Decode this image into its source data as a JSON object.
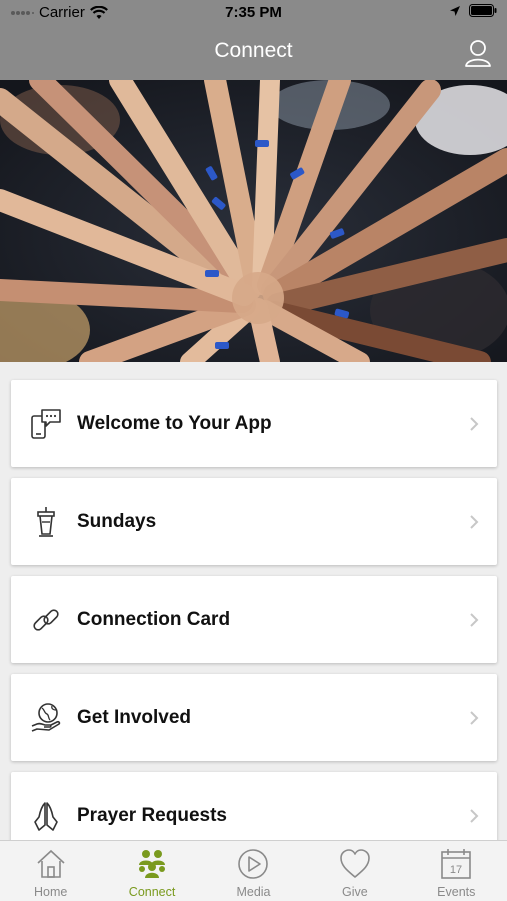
{
  "status": {
    "carrier": "Carrier",
    "time": "7:35 PM"
  },
  "header": {
    "title": "Connect"
  },
  "hero": {
    "icon": "photo-hands-together"
  },
  "items": [
    {
      "label": "Welcome to Your App",
      "icon": "chat-phone-icon"
    },
    {
      "label": "Sundays",
      "icon": "pulpit-icon"
    },
    {
      "label": "Connection Card",
      "icon": "link-icon"
    },
    {
      "label": "Get Involved",
      "icon": "globe-hand-icon"
    },
    {
      "label": "Prayer Requests",
      "icon": "praying-hands-icon"
    }
  ],
  "tabs": [
    {
      "label": "Home",
      "icon": "home-icon"
    },
    {
      "label": "Connect",
      "icon": "people-icon",
      "active": true
    },
    {
      "label": "Media",
      "icon": "play-icon"
    },
    {
      "label": "Give",
      "icon": "heart-icon"
    },
    {
      "label": "Events",
      "icon": "calendar-icon",
      "day": "17"
    }
  ],
  "colors": {
    "header": "#8a8a8a",
    "accent": "#7a9a1e",
    "inactive": "#8a8a8a"
  }
}
